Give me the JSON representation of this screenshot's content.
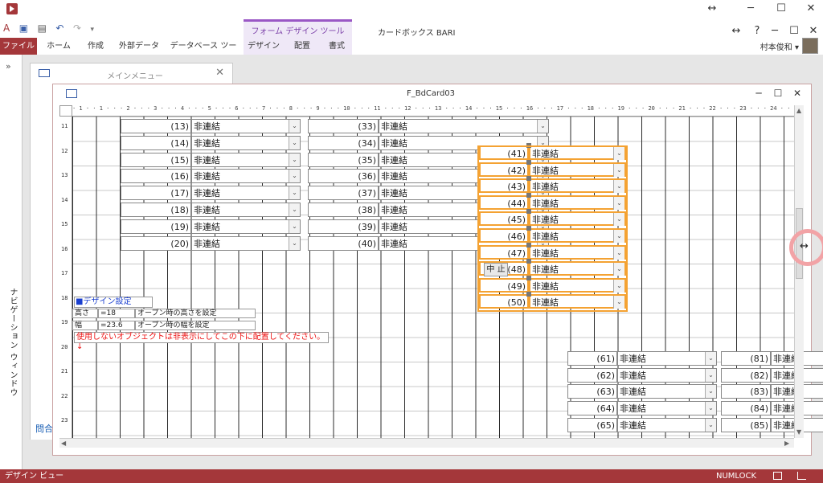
{
  "window": {
    "title": "カードボックス BARI",
    "context_tool_label": "フォーム デザイン ツール",
    "help": "?",
    "min": "─",
    "max": "☐",
    "close": "✕",
    "ribbon_min": "─",
    "ribbon_max": "☐",
    "ribbon_close": "✕",
    "resize": "↔"
  },
  "ribbon": {
    "tabs": [
      "ファイル",
      "ホーム",
      "作成",
      "外部データ",
      "データベース ツール",
      "デザイン",
      "配置",
      "書式"
    ],
    "user": "村本俊和 ▾"
  },
  "nav_pane": {
    "label": "ナビゲーション ウィンドウ",
    "chevron": "»"
  },
  "main_menu": {
    "title": "メインメニュー",
    "close": "✕",
    "link": "問合"
  },
  "form": {
    "title": "F_BdCard03",
    "min": "─",
    "max": "☐",
    "close": "✕"
  },
  "ruler_h": "· 1 · · 1 · · · 2 · · · 3 · · · 4 · · · 5 · · · 6 · · · 7 · · · 8 · · · 9 · · · 10 · · · 11 · · · 12 · · · 13 · · · 14 · · · 15 · · · 16 · · · 17 · · · 18 · · · 19 · · · 20 · · · 21 · · · 22 · · · 23 · · · 24 · · · 25 · · · 26 · · · 27 · · · 28 · · · 29 ·",
  "ruler_v": [
    "11",
    "12",
    "13",
    "14",
    "15",
    "16",
    "17",
    "18",
    "19",
    "20",
    "21",
    "22",
    "23"
  ],
  "combo_value": "非連結",
  "groups": {
    "g1": [
      "(13)",
      "(14)",
      "(15)",
      "(16)",
      "(17)",
      "(18)",
      "(19)",
      "(20)"
    ],
    "g2": [
      "(33)",
      "(34)",
      "(35)",
      "(36)",
      "(37)",
      "(38)",
      "(39)",
      "(40)"
    ],
    "g3": [
      "(41)",
      "(42)",
      "(43)",
      "(44)",
      "(45)",
      "(46)",
      "(47)",
      "(48)",
      "(49)",
      "(50)"
    ],
    "g4": [
      "(61)",
      "(62)",
      "(63)",
      "(64)",
      "(65)"
    ],
    "g5": [
      "(81)",
      "(82)",
      "(83)",
      "(84)",
      "(85)"
    ]
  },
  "stop_button": "中 止",
  "design_settings": {
    "title": "■デザイン設定",
    "height_label": "高さ",
    "height_value": "=18",
    "height_desc": "オープン時の高さを設定",
    "width_label": "幅",
    "width_value": "=23.6",
    "width_desc": "オープン時の幅を設定",
    "warning": "使用しないオブジェクトは非表示にしてこの下に配置してください。↓"
  },
  "status": {
    "left": "デザイン ビュー",
    "numlock": "NUMLOCK"
  },
  "colors": {
    "accent": "#a4373a",
    "selection": "#f4a232",
    "context": "#9a57c5"
  }
}
